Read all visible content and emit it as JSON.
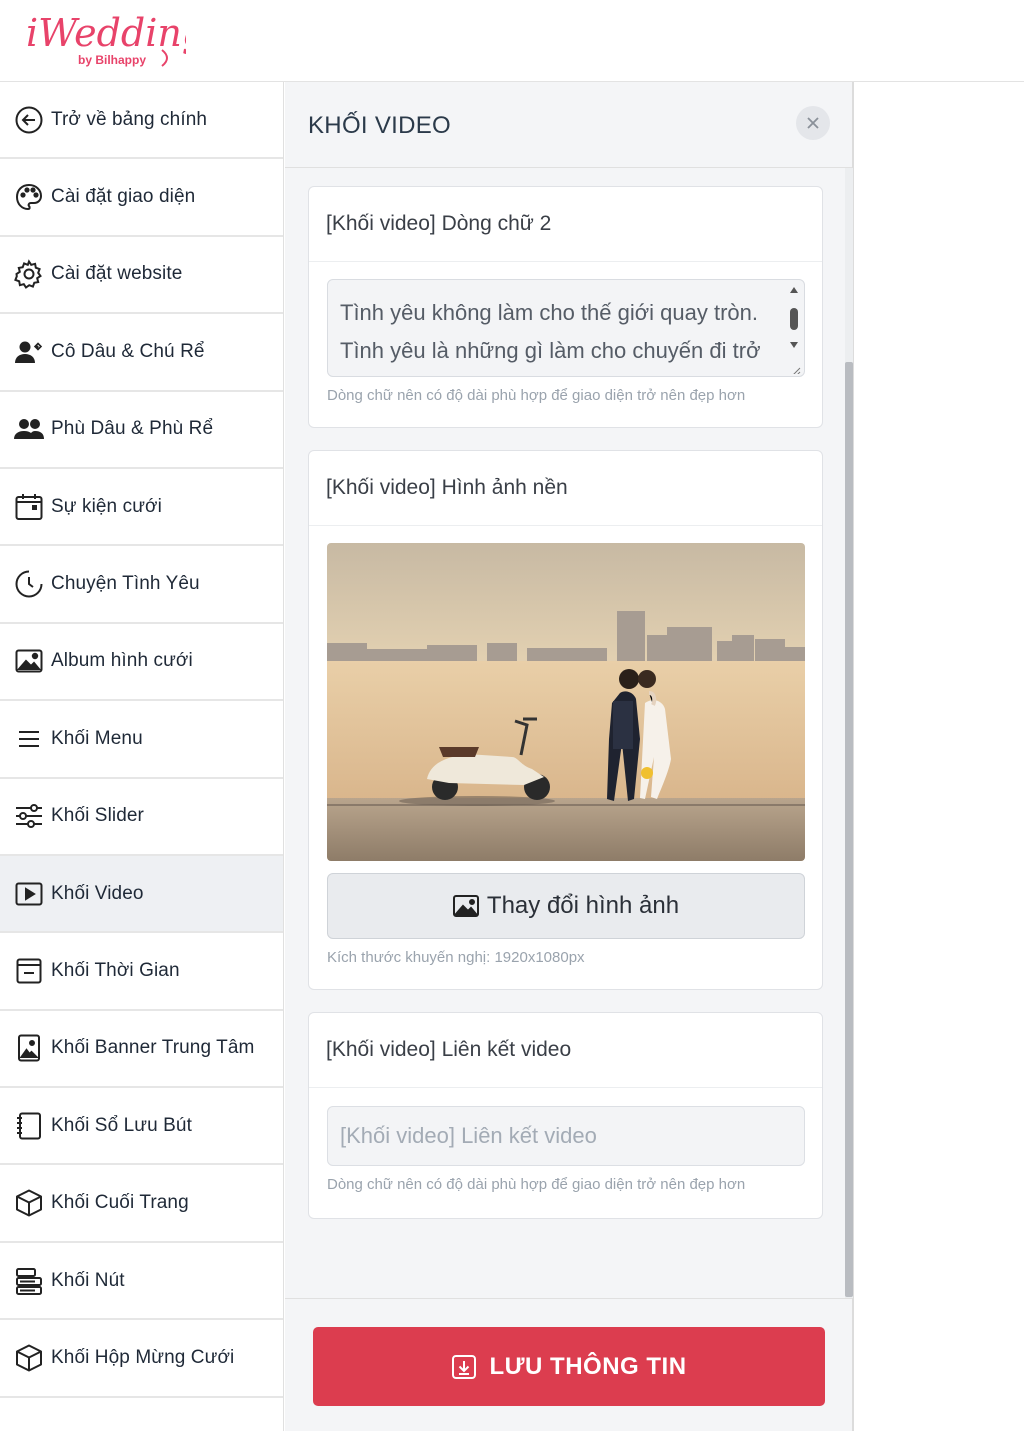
{
  "brand": {
    "logo_main": "iWedding",
    "logo_sub": "by Bilhappy",
    "accent_color": "#e8436a"
  },
  "sidebar": {
    "items": [
      {
        "label": "Trở về bảng chính",
        "icon": "arrow-left-circle-icon"
      },
      {
        "label": "Cài đặt giao diện",
        "icon": "palette-icon"
      },
      {
        "label": "Cài đặt website",
        "icon": "gear-icon"
      },
      {
        "label": "Cô Dâu & Chú Rể",
        "icon": "couple-icon"
      },
      {
        "label": "Phù Dâu & Phù Rể",
        "icon": "people-icon"
      },
      {
        "label": "Sự kiện cưới",
        "icon": "calendar-icon"
      },
      {
        "label": "Chuyện Tình Yêu",
        "icon": "clock-icon"
      },
      {
        "label": "Album hình cưới",
        "icon": "image-icon"
      },
      {
        "label": "Khối Menu",
        "icon": "menu-icon"
      },
      {
        "label": "Khối Slider",
        "icon": "sliders-icon"
      },
      {
        "label": "Khối Video",
        "icon": "play-icon",
        "active": true
      },
      {
        "label": "Khối Thời Gian",
        "icon": "calendar-minus-icon"
      },
      {
        "label": "Khối Banner Trung Tâm",
        "icon": "portrait-icon"
      },
      {
        "label": "Khối Sổ Lưu Bút",
        "icon": "notebook-icon"
      },
      {
        "label": "Khối Cuối Trang",
        "icon": "box-icon"
      },
      {
        "label": "Khối Nút",
        "icon": "buttons-icon"
      },
      {
        "label": "Khối Hộp Mừng Cưới",
        "icon": "gift-box-icon"
      }
    ]
  },
  "panel": {
    "title": "KHỐI VIDEO",
    "text_card": {
      "label": "[Khối video] Dòng chữ 2",
      "value": "Tình yêu không làm cho thế giới quay tròn. Tình yêu là những gì làm cho chuyến đi trở nên đáng giá.",
      "hint": "Dòng chữ nên có độ dài phù hợp để giao diện trở nên đẹp hơn"
    },
    "image_card": {
      "label": "[Khối video] Hình ảnh nền",
      "button_label": "Thay đổi hình ảnh",
      "hint": "Kích thước khuyến nghị: 1920x1080px"
    },
    "link_card": {
      "label": "[Khối video] Liên kết video",
      "placeholder": "[Khối video] Liên kết video",
      "hint": "Dòng chữ nên có độ dài phù hợp để giao diện trở nên đẹp hơn"
    },
    "save_label": "LƯU THÔNG TIN"
  }
}
